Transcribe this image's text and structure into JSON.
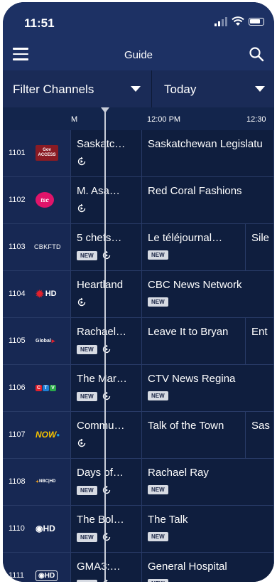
{
  "status": {
    "time": "11:51"
  },
  "header": {
    "title": "Guide"
  },
  "filters": {
    "channels_label": "Filter Channels",
    "day_label": "Today"
  },
  "timebar": {
    "prev_fragment": "M",
    "slot1": "12:00 PM",
    "slot2": "12:30"
  },
  "colors": {
    "background": "#0f1e3e",
    "header": "#1d3164",
    "badge": "#d7dbe3"
  },
  "rows": [
    {
      "number": "1101",
      "logo": "Gov ACCESS",
      "logo_icon": "gov-access-logo",
      "programs": [
        {
          "title": "Saskatc…",
          "new": "",
          "replay": true
        },
        {
          "title": "Saskatchewan Legislatu",
          "new": "",
          "replay": false
        }
      ]
    },
    {
      "number": "1102",
      "logo": "TSC",
      "logo_icon": "tsc-logo",
      "programs": [
        {
          "title": "M. Asa…",
          "new": "",
          "replay": true
        },
        {
          "title": "Red Coral Fashions",
          "new": "",
          "replay": false
        }
      ]
    },
    {
      "number": "1103",
      "logo": "CBKFTD",
      "logo_icon": "cbkftd-logo",
      "programs": [
        {
          "title": "5 chefs…",
          "new": "NEW",
          "replay": true
        },
        {
          "title": "Le téléjournal…",
          "new": "NEW",
          "replay": false
        },
        {
          "title": "Sile",
          "new": "",
          "replay": false
        }
      ]
    },
    {
      "number": "1104",
      "logo": "HD",
      "logo_icon": "cbc-hd-logo",
      "programs": [
        {
          "title": "Heartland",
          "new": "",
          "replay": true
        },
        {
          "title": "CBC News Network",
          "new": "NEW",
          "replay": false
        }
      ]
    },
    {
      "number": "1105",
      "logo": "Global",
      "logo_icon": "global-logo",
      "programs": [
        {
          "title": "Rachael…",
          "new": "NEW",
          "replay": true
        },
        {
          "title": "Leave It to Bryan",
          "new": "",
          "replay": false
        },
        {
          "title": "Ent",
          "new": "",
          "replay": false
        }
      ]
    },
    {
      "number": "1106",
      "logo": "CTV",
      "logo_icon": "ctv-logo",
      "programs": [
        {
          "title": "The Mar…",
          "new": "NEW",
          "replay": true
        },
        {
          "title": "CTV News Regina",
          "new": "NEW",
          "replay": false
        }
      ]
    },
    {
      "number": "1107",
      "logo": "NOW",
      "logo_icon": "shaw-now-logo",
      "programs": [
        {
          "title": "Commu…",
          "new": "",
          "replay": true
        },
        {
          "title": "Talk of the Town",
          "new": "",
          "replay": false
        },
        {
          "title": "Sas",
          "new": "",
          "replay": false
        }
      ]
    },
    {
      "number": "1108",
      "logo": "NBC HD",
      "logo_icon": "nbc-hd-logo",
      "programs": [
        {
          "title": "Days of…",
          "new": "NEW",
          "replay": true
        },
        {
          "title": "Rachael Ray",
          "new": "NEW",
          "replay": false
        }
      ]
    },
    {
      "number": "1110",
      "logo": "HD",
      "logo_icon": "cbs-hd-logo",
      "programs": [
        {
          "title": "The Bol…",
          "new": "NEW",
          "replay": true
        },
        {
          "title": "The Talk",
          "new": "NEW",
          "replay": false
        }
      ]
    },
    {
      "number": "1111",
      "logo": "HD",
      "logo_icon": "abc-hd-logo",
      "programs": [
        {
          "title": "GMA3:…",
          "new": "NEW",
          "replay": true
        },
        {
          "title": "General Hospital",
          "new": "NEW",
          "replay": false
        }
      ]
    }
  ]
}
